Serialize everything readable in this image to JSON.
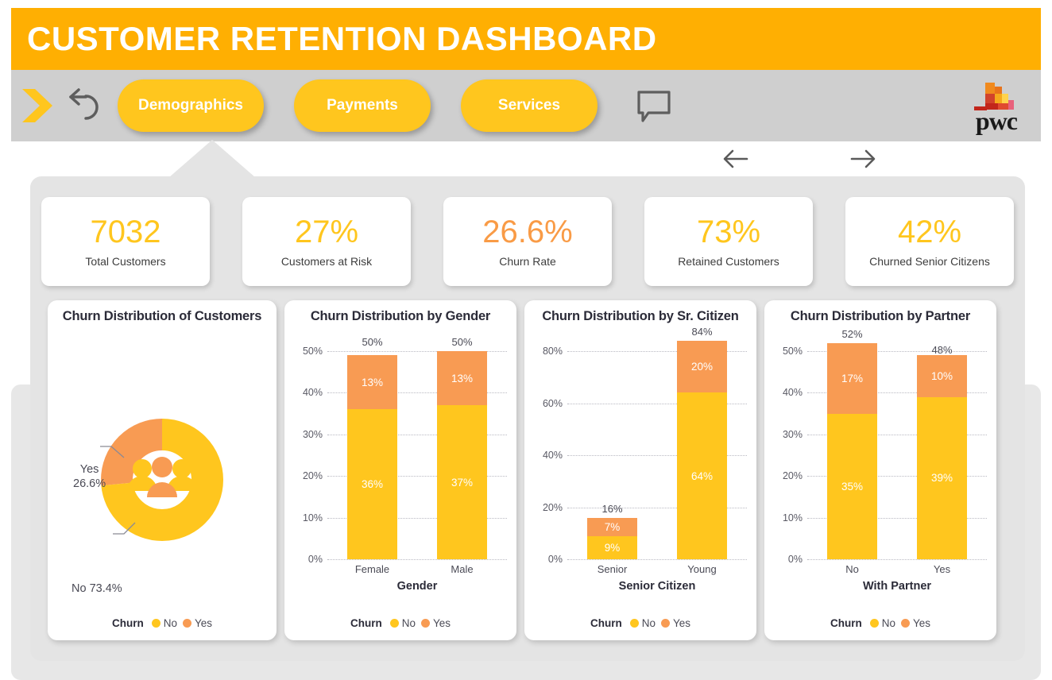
{
  "header": {
    "title": "CUSTOMER RETENTION DASHBOARD",
    "bar_color": "#FFAF02"
  },
  "nav": {
    "forward_icon": "chevron-right-icon",
    "back_icon": "undo-arrow-icon",
    "comment_icon": "comment-bubble-icon",
    "tabs": [
      {
        "label": "Demographics",
        "active": true
      },
      {
        "label": "Payments",
        "active": false
      },
      {
        "label": "Services",
        "active": false
      }
    ],
    "logo_text": "pwc",
    "page_prev_icon": "arrow-left-icon",
    "page_next_icon": "arrow-right-icon"
  },
  "colors": {
    "yellow": "#FFC61E",
    "orange": "#F89B53",
    "header_orange": "#FFAF02",
    "navbar_gray": "#cfcfcf",
    "panel_gray": "#e4e4e4"
  },
  "kpis": [
    {
      "value": "7032",
      "label": "Total Customers",
      "color": "#FFC61E"
    },
    {
      "value": "27%",
      "label": "Customers at Risk",
      "color": "#FFC61E"
    },
    {
      "value": "26.6%",
      "label": "Churn Rate",
      "color": "#F99B46"
    },
    {
      "value": "73%",
      "label": "Retained Customers",
      "color": "#FFC61E"
    },
    {
      "value": "42%",
      "label": "Churned Senior Citizens",
      "color": "#FFC61E"
    }
  ],
  "legend": {
    "title": "Churn",
    "items": [
      {
        "label": "No",
        "color": "#FFC61E"
      },
      {
        "label": "Yes",
        "color": "#F89B53"
      }
    ]
  },
  "chart_data": [
    {
      "type": "pie",
      "title": "Churn Distribution of Customers",
      "center_icon": "people-group-icon",
      "labels": [
        "No",
        "Yes"
      ],
      "values": [
        73.4,
        26.6
      ],
      "value_labels": [
        "No 73.4%",
        "Yes\n26.6%"
      ],
      "slice_colors": [
        "#FFC61E",
        "#F89B53"
      ],
      "legend_title": "Churn",
      "legend_position": "bottom"
    },
    {
      "type": "bar",
      "title": "Churn Distribution by Gender",
      "stacked": true,
      "categories": [
        "Female",
        "Male"
      ],
      "series": [
        {
          "name": "No",
          "values": [
            36,
            37
          ],
          "color": "#FFC61E"
        },
        {
          "name": "Yes",
          "values": [
            13,
            13
          ],
          "color": "#F89B53"
        }
      ],
      "totals": [
        50,
        50
      ],
      "total_labels": [
        "50%",
        "50%"
      ],
      "xlabel": "Gender",
      "ylabel": "",
      "ylim": [
        0,
        50
      ],
      "yticks": [
        0,
        10,
        20,
        30,
        40,
        50
      ],
      "ytick_labels": [
        "0%",
        "10%",
        "20%",
        "30%",
        "40%",
        "50%"
      ],
      "grid": true,
      "legend_title": "Churn",
      "legend_position": "bottom"
    },
    {
      "type": "bar",
      "title": "Churn Distribution by Sr. Citizen",
      "stacked": true,
      "categories": [
        "Senior",
        "Young"
      ],
      "series": [
        {
          "name": "No",
          "values": [
            9,
            64
          ],
          "color": "#FFC61E"
        },
        {
          "name": "Yes",
          "values": [
            7,
            20
          ],
          "color": "#F89B53"
        }
      ],
      "totals": [
        16,
        84
      ],
      "total_labels": [
        "16%",
        "84%"
      ],
      "xlabel": "Senior Citizen",
      "ylabel": "",
      "ylim": [
        0,
        80
      ],
      "yticks": [
        0,
        20,
        40,
        60,
        80
      ],
      "ytick_labels": [
        "0%",
        "20%",
        "40%",
        "60%",
        "80%"
      ],
      "grid": true,
      "legend_title": "Churn",
      "legend_position": "bottom"
    },
    {
      "type": "bar",
      "title": "Churn Distribution by Partner",
      "stacked": true,
      "categories": [
        "No",
        "Yes"
      ],
      "series": [
        {
          "name": "No",
          "values": [
            35,
            39
          ],
          "color": "#FFC61E"
        },
        {
          "name": "Yes",
          "values": [
            17,
            10
          ],
          "color": "#F89B53"
        }
      ],
      "totals": [
        52,
        48
      ],
      "total_labels": [
        "52%",
        "48%"
      ],
      "xlabel": "With Partner",
      "ylabel": "",
      "ylim": [
        0,
        50
      ],
      "yticks": [
        0,
        10,
        20,
        30,
        40,
        50
      ],
      "ytick_labels": [
        "0%",
        "10%",
        "20%",
        "30%",
        "40%",
        "50%"
      ],
      "grid": true,
      "legend_title": "Churn",
      "legend_position": "bottom"
    }
  ]
}
